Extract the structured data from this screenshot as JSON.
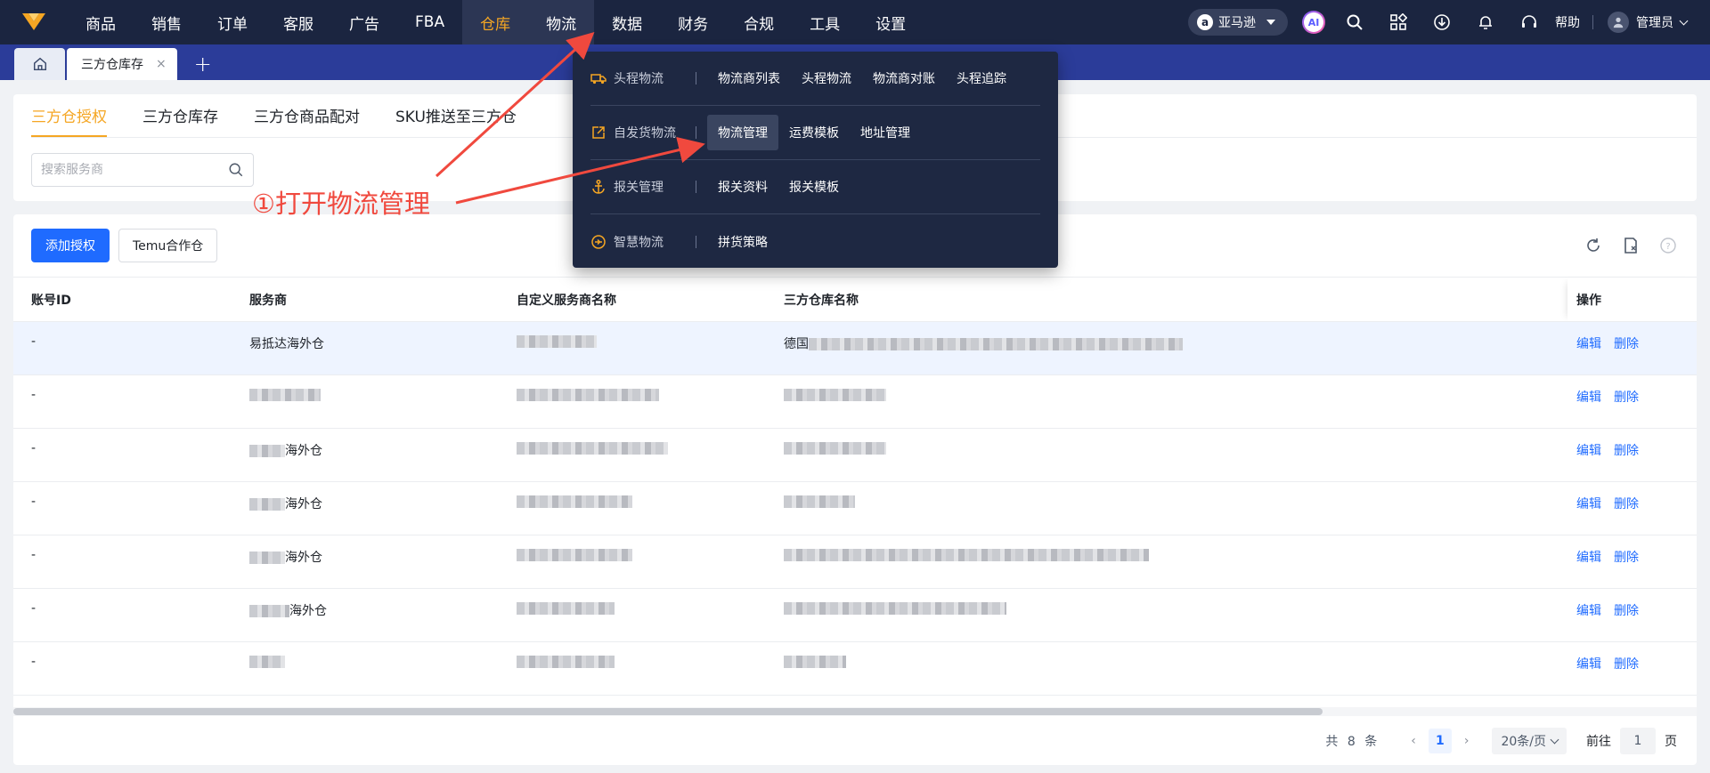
{
  "topnav": {
    "items": [
      {
        "label": "商品",
        "state": "normal"
      },
      {
        "label": "销售",
        "state": "normal"
      },
      {
        "label": "订单",
        "state": "normal"
      },
      {
        "label": "客服",
        "state": "normal"
      },
      {
        "label": "广告",
        "state": "normal"
      },
      {
        "label": "FBA",
        "state": "normal"
      },
      {
        "label": "仓库",
        "state": "active"
      },
      {
        "label": "物流",
        "state": "hover"
      },
      {
        "label": "数据",
        "state": "normal"
      },
      {
        "label": "财务",
        "state": "normal"
      },
      {
        "label": "合规",
        "state": "normal"
      },
      {
        "label": "工具",
        "state": "normal"
      },
      {
        "label": "设置",
        "state": "normal"
      }
    ],
    "store": "亚马逊",
    "store_icon": "a",
    "ai_label": "AI",
    "help": "帮助",
    "user": "管理员",
    "accent": "#f5a623",
    "bg": "#1b2540"
  },
  "tabbar": {
    "open_tab": "三方仓库存",
    "close_glyph": "×",
    "add_glyph": "+"
  },
  "filter": {
    "sub_tabs": [
      {
        "label": "三方仓授权",
        "active": true
      },
      {
        "label": "三方仓库存",
        "active": false
      },
      {
        "label": "三方仓商品配对",
        "active": false
      },
      {
        "label": "SKU推送至三方仓",
        "active": false
      }
    ],
    "search_placeholder": "搜索服务商"
  },
  "toolbar": {
    "add_label": "添加授权",
    "temu_label": "Temu合作仓"
  },
  "table": {
    "columns": [
      "账号ID",
      "服务商",
      "自定义服务商名称",
      "三方仓库名称",
      "操作"
    ],
    "rows": [
      {
        "id": "-",
        "provider": "易抵达海外仓",
        "custom": "",
        "warehouse": "德国",
        "highlight": true
      },
      {
        "id": "-",
        "provider": "",
        "custom": "",
        "warehouse": "",
        "highlight": false
      },
      {
        "id": "-",
        "provider": "海外仓",
        "custom": "",
        "warehouse": "",
        "highlight": false
      },
      {
        "id": "-",
        "provider": "海外仓",
        "custom": "",
        "warehouse": "",
        "highlight": false
      },
      {
        "id": "-",
        "provider": "海外仓",
        "custom": "",
        "warehouse": "",
        "highlight": false
      },
      {
        "id": "-",
        "provider": "海外仓",
        "custom": "",
        "warehouse": "",
        "highlight": false
      },
      {
        "id": "-",
        "provider": "",
        "custom": "",
        "warehouse": "",
        "highlight": false
      }
    ],
    "edit_label": "编辑",
    "delete_label": "删除"
  },
  "pager": {
    "total_prefix": "共",
    "total": "8",
    "total_suffix": "条",
    "prev": "‹",
    "next": "›",
    "current_page": "1",
    "page_size": "20条/页",
    "goto_label": "前往",
    "goto_value": "1",
    "goto_unit": "页"
  },
  "mega_menu": {
    "rows": [
      {
        "category": "头程物流",
        "icon": "truck-icon",
        "links": [
          "物流商列表",
          "头程物流",
          "物流商对账",
          "头程追踪"
        ],
        "hover": -1
      },
      {
        "category": "自发货物流",
        "icon": "share-box-icon",
        "links": [
          "物流管理",
          "运费模板",
          "地址管理"
        ],
        "hover": 0
      },
      {
        "category": "报关管理",
        "icon": "anchor-icon",
        "links": [
          "报关资料",
          "报关模板"
        ],
        "hover": -1
      },
      {
        "category": "智慧物流",
        "icon": "smart-logistics-icon",
        "links": [
          "拼货策略"
        ],
        "hover": -1
      }
    ]
  },
  "annotation": {
    "text": "①打开物流管理",
    "color": "#f0493e"
  }
}
